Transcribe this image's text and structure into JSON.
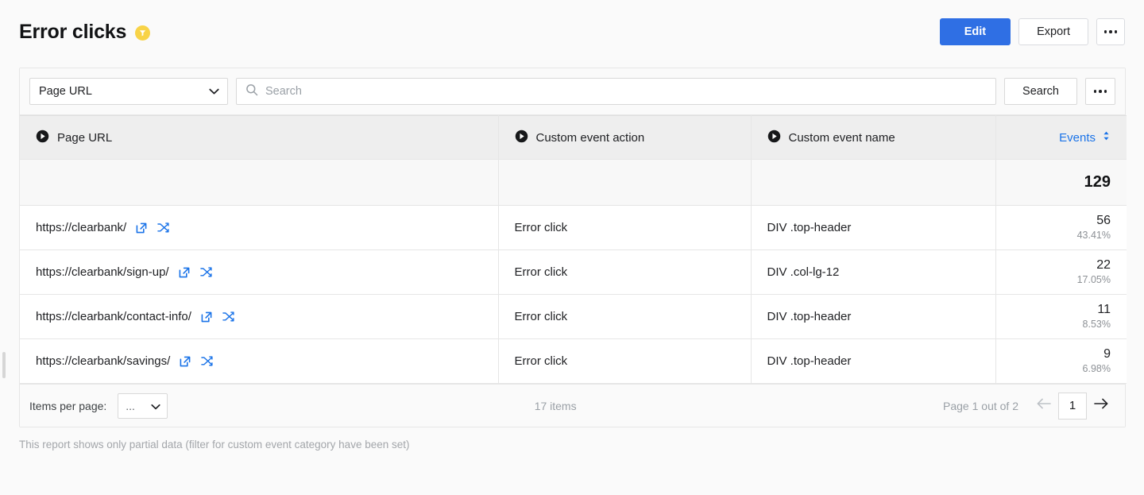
{
  "header": {
    "title": "Error clicks",
    "filter_badge_icon": "filter-funnel-icon",
    "edit_label": "Edit",
    "export_label": "Export",
    "more_label": "",
    "accent_color": "#2f6fe4",
    "badge_color": "#f8d347"
  },
  "search": {
    "dimension_selected": "Page URL",
    "placeholder": "Search",
    "value": "",
    "search_button_label": "Search",
    "search_icon": "magnifier-icon",
    "more_icon": "ellipsis-icon"
  },
  "table": {
    "columns": [
      {
        "label": "Page URL",
        "icon": "dimension-play-icon",
        "type": "dimension"
      },
      {
        "label": "Custom event action",
        "icon": "dimension-play-icon",
        "type": "dimension"
      },
      {
        "label": "Custom event name",
        "icon": "dimension-play-icon",
        "type": "dimension"
      },
      {
        "label": "Events",
        "icon": "sort-updown-icon",
        "type": "metric",
        "color": "#1a73e8"
      }
    ],
    "totals": {
      "events": "129"
    },
    "rows": [
      {
        "page_url": "https://clearbank/",
        "custom_event_action": "Error click",
        "custom_event_name": "DIV .top-header",
        "events": "56",
        "percent": "43.41%"
      },
      {
        "page_url": "https://clearbank/sign-up/",
        "custom_event_action": "Error click",
        "custom_event_name": "DIV .col-lg-12",
        "events": "22",
        "percent": "17.05%"
      },
      {
        "page_url": "https://clearbank/contact-info/",
        "custom_event_action": "Error click",
        "custom_event_name": "DIV .top-header",
        "events": "11",
        "percent": "8.53%"
      },
      {
        "page_url": "https://clearbank/savings/",
        "custom_event_action": "Error click",
        "custom_event_name": "DIV .top-header",
        "events": "9",
        "percent": "6.98%"
      }
    ],
    "row_icons": {
      "open_link": "external-link-icon",
      "segment": "segment-crossing-arrows-icon"
    }
  },
  "pagination": {
    "items_per_page_label": "Items per page:",
    "items_per_page_value": "...",
    "items_count": "17 items",
    "page_status": "Page 1 out of 2",
    "current_page": "1",
    "prev_icon": "arrow-left-icon",
    "next_icon": "arrow-right-icon"
  },
  "footnote": "This report shows only partial data (filter for custom event category have been set)"
}
